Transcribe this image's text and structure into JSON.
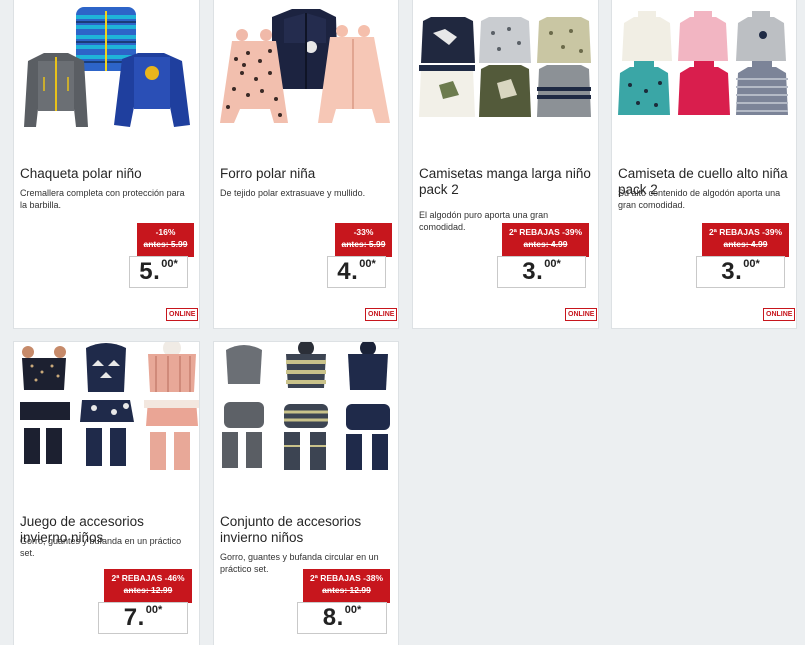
{
  "products": [
    {
      "title": "Chaqueta polar niño",
      "description": "Cremallera completa con protección para la barbilla.",
      "discount": "-16%",
      "old_price": "antes: 5.99",
      "price_main": "5.",
      "price_cents": "00*",
      "badge": "ONLINE"
    },
    {
      "title": "Forro polar niña",
      "description": "De tejido polar extrasuave y mullido.",
      "discount": "-33%",
      "old_price": "antes: 5.99",
      "price_main": "4.",
      "price_cents": "00*",
      "badge": "ONLINE"
    },
    {
      "title": "Camisetas manga larga niño pack 2",
      "description": "El algodón puro aporta una gran comodidad.",
      "discount": "2ª REBAJAS -39%",
      "old_price": "antes: 4.99",
      "price_main": "3.",
      "price_cents": "00*",
      "badge": "ONLINE"
    },
    {
      "title": "Camiseta de cuello alto niña pack 2",
      "description": "Su alto contenido de algodón aporta una gran comodidad.",
      "discount": "2ª REBAJAS -39%",
      "old_price": "antes: 4.99",
      "price_main": "3.",
      "price_cents": "00*",
      "badge": "ONLINE"
    },
    {
      "title": "Juego de accesorios invierno niños",
      "description": "Gorro, guantes y bufanda en un práctico set.",
      "discount": "2ª REBAJAS -46%",
      "old_price": "antes: 12.99",
      "price_main": "7.",
      "price_cents": "00*"
    },
    {
      "title": "Conjunto de accesorios invierno niños",
      "description": "Gorro, guantes y bufanda circular en un práctico set.",
      "discount": "2ª REBAJAS -38%",
      "old_price": "antes: 12.99",
      "price_main": "8.",
      "price_cents": "00*"
    }
  ],
  "colors": {
    "accent_red": "#c7161d",
    "page_bg": "#eceff1"
  }
}
